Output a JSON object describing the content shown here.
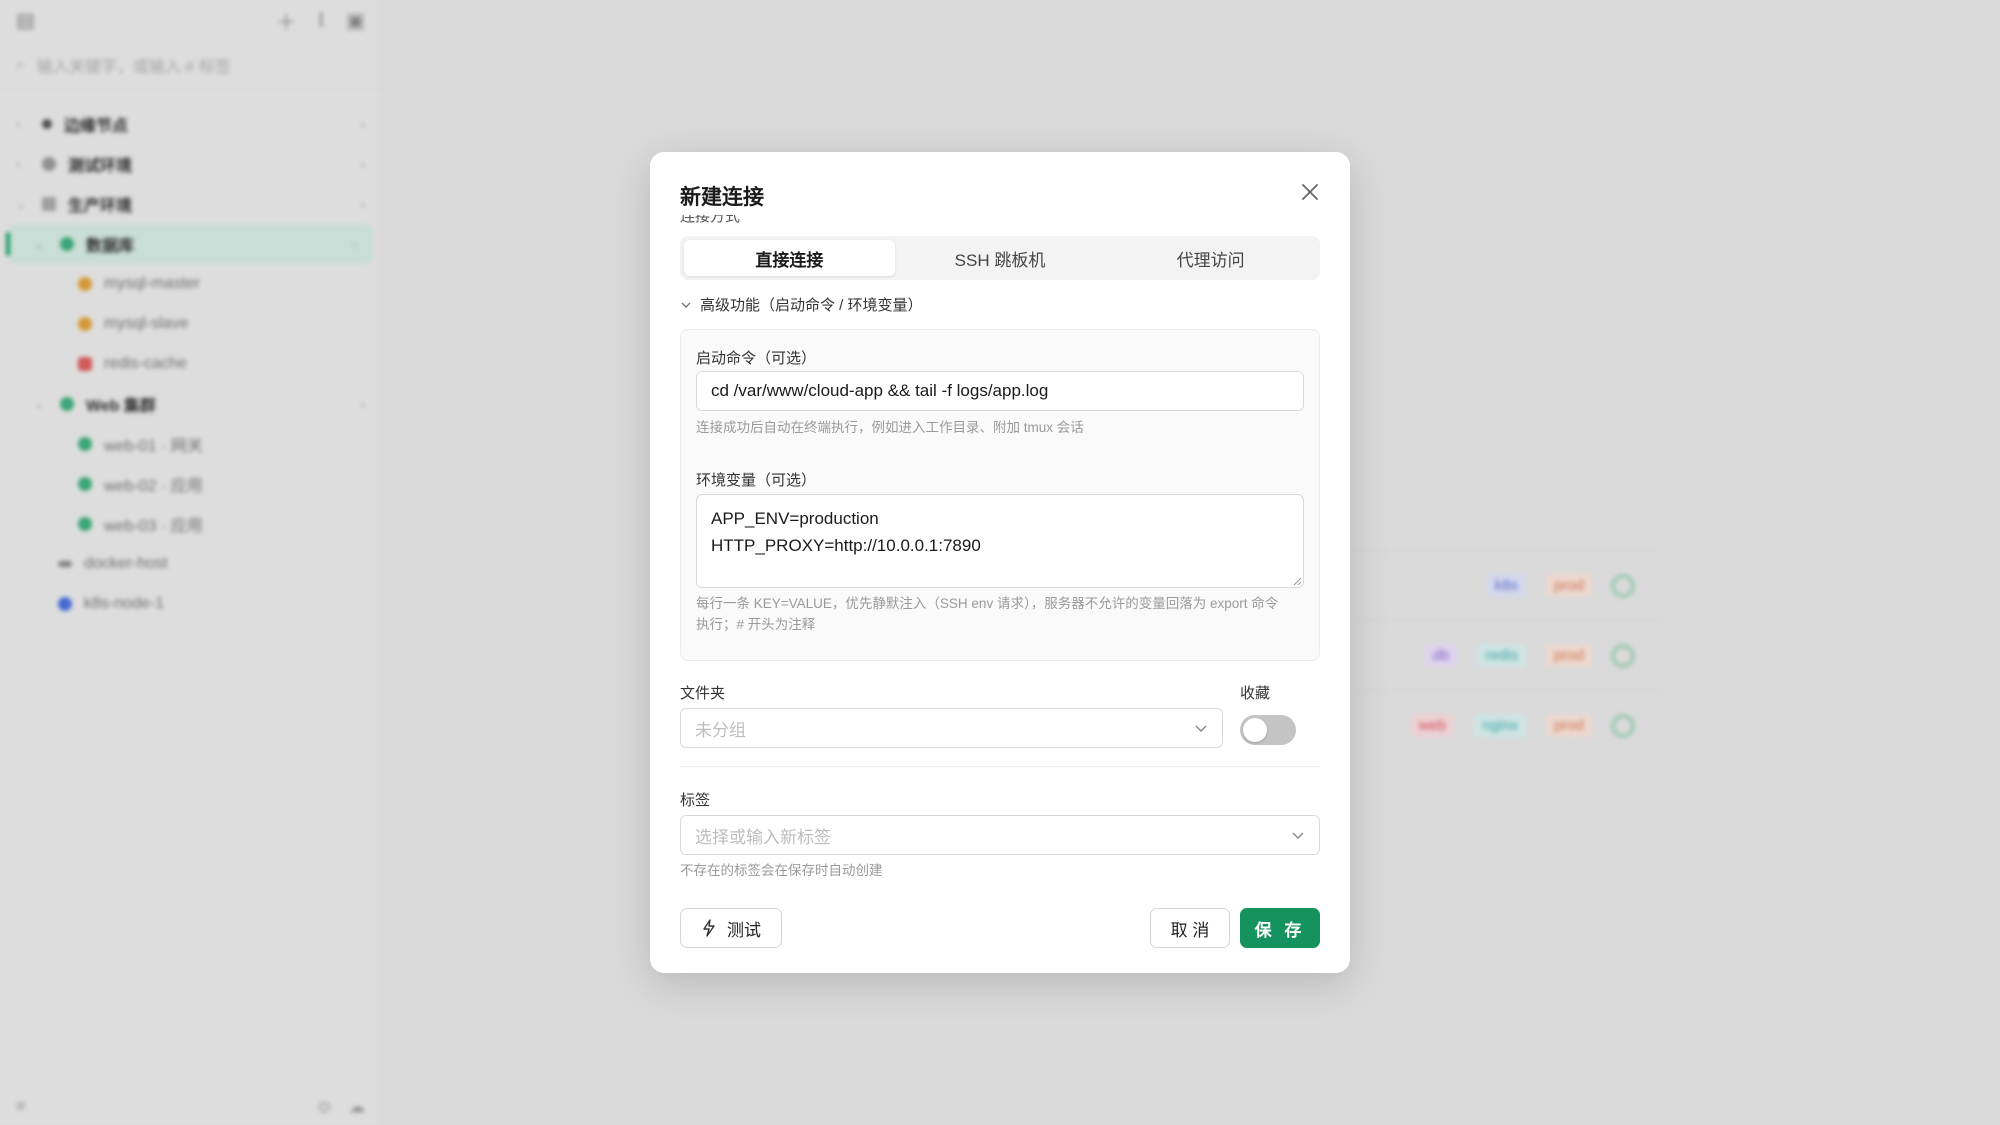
{
  "sidebar": {
    "search_placeholder": "输入关键字，或输入 # 标签",
    "items": [
      {
        "label": "边缘节点"
      },
      {
        "label": "测试环境"
      },
      {
        "label": "生产环境"
      },
      {
        "label": "数据库"
      },
      {
        "label": "mysql-master"
      },
      {
        "label": "mysql-slave"
      },
      {
        "label": "redis-cache"
      },
      {
        "label": "Web 集群"
      },
      {
        "label": "web-01 · 网关"
      },
      {
        "label": "web-02 · 应用"
      },
      {
        "label": "web-03 · 应用"
      },
      {
        "label": "docker-host"
      },
      {
        "label": "k8s-node-1"
      }
    ]
  },
  "main": {
    "rows": [
      {
        "tags": [
          "k8s",
          "prod"
        ]
      },
      {
        "tags": [
          "db",
          "redis",
          "prod"
        ]
      },
      {
        "tags": [
          "web",
          "nginx",
          "prod"
        ]
      }
    ]
  },
  "modal": {
    "title": "新建连接",
    "connection_mode_label": "连接方式",
    "modes": [
      "直接连接",
      "SSH 跳板机",
      "代理访问"
    ],
    "selected_mode": "直接连接",
    "advanced_toggle": "高级功能（启动命令 / 环境变量）",
    "startup": {
      "label": "启动命令（可选）",
      "value": "cd /var/www/cloud-app && tail -f logs/app.log",
      "help": "连接成功后自动在终端执行，例如进入工作目录、附加 tmux 会话"
    },
    "env": {
      "label": "环境变量（可选）",
      "value": "APP_ENV=production\nHTTP_PROXY=http://10.0.0.1:7890",
      "help_line1": "每行一条 KEY=VALUE，优先静默注入（SSH env 请求），服务器不允许的变量回落为 export 命令",
      "help_line2": "执行；# 开头为注释"
    },
    "folder": {
      "label": "文件夹",
      "placeholder": "未分组"
    },
    "favorite": {
      "label": "收藏",
      "enabled": false
    },
    "tags": {
      "label": "标签",
      "placeholder": "选择或输入新标签",
      "help": "不存在的标签会在保存时自动创建"
    },
    "buttons": {
      "test": "测试",
      "cancel": "取 消",
      "save": "保 存"
    }
  },
  "colors": {
    "primary": "#14935e",
    "active_bg": "#d6ece4"
  }
}
